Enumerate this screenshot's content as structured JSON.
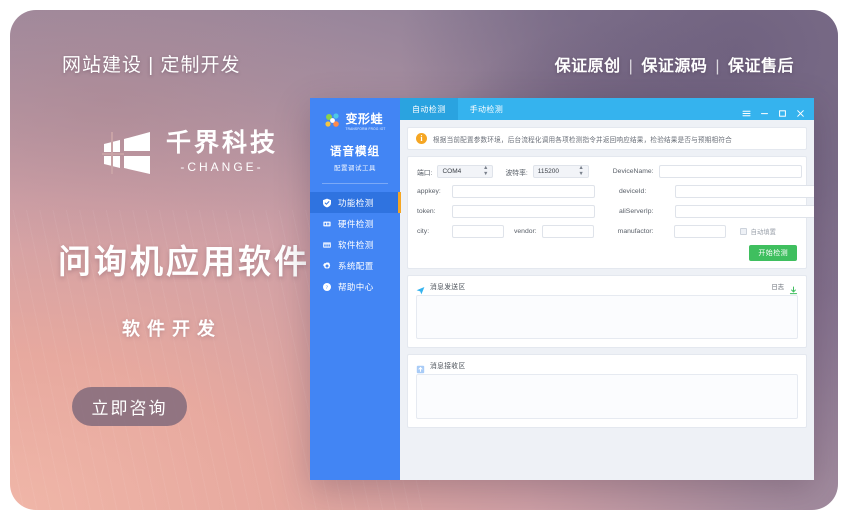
{
  "banner": {
    "header_left": "网站建设 | 定制开发",
    "header_right_items": [
      "保证原创",
      "保证源码",
      "保证售后"
    ],
    "brand": {
      "cn": "千界科技",
      "en": "-CHANGE-",
      "mark": "window-logo-icon"
    },
    "promo_title": "问询机应用软件",
    "promo_subtitle": "软件开发",
    "cta_label": "立即咨询",
    "colors": {
      "gradient_start": "#f0b6a8",
      "gradient_end": "#8d7f97",
      "cta_bg": "#7e687a"
    }
  },
  "app": {
    "sidebar": {
      "logo_text": "变形蛙",
      "logo_subtext": "TRANSFORM FROG IOT",
      "title": "语音模组",
      "subtitle": "配置调试工具",
      "items": [
        {
          "label": "功能检测",
          "icon": "shield-check-icon",
          "active": true
        },
        {
          "label": "硬件检测",
          "icon": "chip-icon",
          "active": false
        },
        {
          "label": "软件检测",
          "icon": "window-grid-icon",
          "active": false
        },
        {
          "label": "系统配置",
          "icon": "gear-icon",
          "active": false
        },
        {
          "label": "帮助中心",
          "icon": "help-circle-icon",
          "active": false
        }
      ],
      "colors": {
        "bg": "#4285f4",
        "active_bg": "#2f73e0",
        "active_marker": "#f5a623"
      }
    },
    "titlebar": {
      "tabs": [
        {
          "label": "自动检测",
          "active": true
        },
        {
          "label": "手动检测",
          "active": false
        }
      ],
      "window_buttons": [
        "menu-icon",
        "minimize-icon",
        "maximize-icon",
        "close-icon"
      ],
      "color": "#35b3ee"
    },
    "notice": {
      "icon": "info-icon",
      "icon_glyph": "i",
      "text": "根据当前配置参数环境，后台流程化调用各项检测指令并返回响应结果，检验结果是否与预期相符合"
    },
    "form": {
      "port": {
        "label": "端口:",
        "value": "COM4"
      },
      "baud": {
        "label": "波特率:",
        "value": "115200"
      },
      "device_name": {
        "label": "DeviceName:",
        "value": "",
        "placeholder": ""
      },
      "appkey": {
        "label": "appkey:",
        "value": "",
        "placeholder": ""
      },
      "device_id": {
        "label": "deviceId:",
        "value": "",
        "placeholder": ""
      },
      "token": {
        "label": "token:",
        "value": "",
        "placeholder": ""
      },
      "ali_server_ip": {
        "label": "aliServerIp:",
        "value": "",
        "placeholder": ""
      },
      "city": {
        "label": "city:",
        "value": "",
        "placeholder": ""
      },
      "vendor": {
        "label": "vendor:",
        "value": "",
        "placeholder": ""
      },
      "manufactor": {
        "label": "manufactor:",
        "value": "",
        "placeholder": ""
      },
      "auto_fill": {
        "label": "自动填置",
        "checked": false
      },
      "submit_label": "开始检测",
      "submit_color": "#3fbf5f"
    },
    "send_panel": {
      "icon": "send-plane-icon",
      "title": "消息发送区",
      "action_label": "日志",
      "action_icon": "download-icon",
      "value": ""
    },
    "receive_panel": {
      "icon": "inbox-arrow-icon",
      "title": "消息接收区",
      "value": ""
    }
  }
}
